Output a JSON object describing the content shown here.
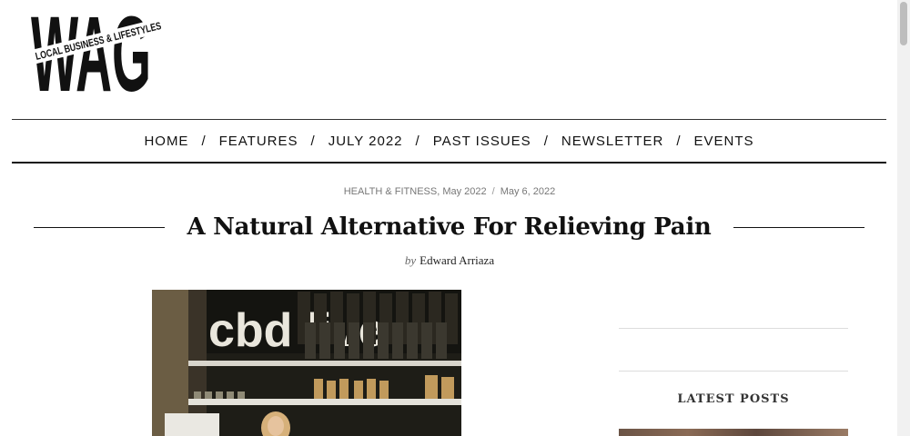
{
  "logo": {
    "letters": "WAG",
    "tagline": "LOCAL BUSINESS & LIFESTYLES"
  },
  "nav": {
    "items": [
      "HOME",
      "FEATURES",
      "JULY 2022",
      "PAST ISSUES",
      "NEWSLETTER",
      "EVENTS"
    ],
    "separator": "/"
  },
  "post": {
    "categories": "HEALTH & FITNESS, May 2022",
    "date_separator": "/",
    "date": "May 6, 2022",
    "title": "A Natural Alternative For Relieving Pain",
    "by_label": "by",
    "author": "Edward Arriaza",
    "image_sign_text": "cbd live"
  },
  "sidebar": {
    "latest_posts_title": "LATEST POSTS"
  },
  "colors": {
    "text": "#111111",
    "meta": "#777777",
    "rule": "#dddddd",
    "accent_dark": "#1a1a14"
  }
}
